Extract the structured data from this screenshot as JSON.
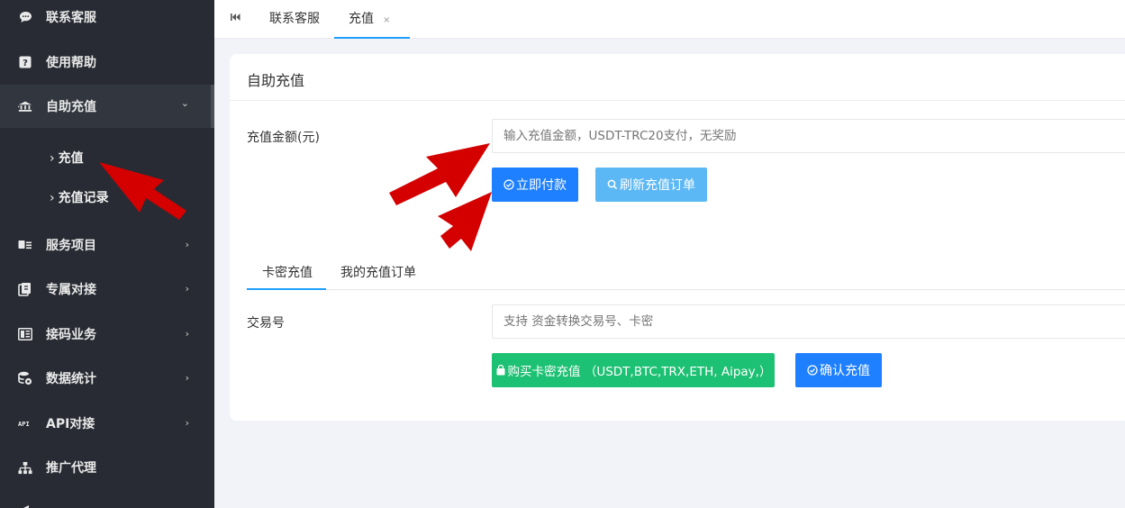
{
  "sidebar": {
    "items": [
      {
        "label": "联系客服",
        "icon": "chat-icon"
      },
      {
        "label": "使用帮助",
        "icon": "help-icon"
      },
      {
        "label": "自助充值",
        "icon": "bank-icon"
      },
      {
        "label": "服务项目",
        "icon": "card-icon"
      },
      {
        "label": "专属对接",
        "icon": "pin-icon"
      },
      {
        "label": "接码业务",
        "icon": "sms-icon"
      },
      {
        "label": "数据统计",
        "icon": "database-icon"
      },
      {
        "label": "API对接",
        "icon": "api-icon"
      },
      {
        "label": "推广代理",
        "icon": "sitemap-icon"
      }
    ],
    "sub_items": [
      {
        "label": "充值"
      },
      {
        "label": "充值记录"
      }
    ]
  },
  "tabs": {
    "home_icon": "first-page-icon",
    "items": [
      {
        "label": "联系客服"
      },
      {
        "label": "充值",
        "close": "×"
      }
    ]
  },
  "card": {
    "title": "自助充值",
    "amount_label": "充值金额(元)",
    "amount_placeholder": "输入充值金额，USDT-TRC20支付，无奖励",
    "pay_button": "立即付款",
    "refresh_button": "刷新充值订单",
    "subtabs": [
      {
        "label": "卡密充值"
      },
      {
        "label": "我的充值订单"
      }
    ],
    "txn_label": "交易号",
    "txn_placeholder": "支持 资金转换交易号、卡密",
    "buy_button": "购买卡密充值 （USDT,BTC,TRX,ETH, Aipay,）",
    "confirm_button": "确认充值"
  },
  "colors": {
    "sidebar_bg": "#282b33",
    "accent_blue": "#1e80ff",
    "light_blue": "#5cb8f5",
    "green": "#1dc173",
    "arrow_red": "#d40000"
  }
}
